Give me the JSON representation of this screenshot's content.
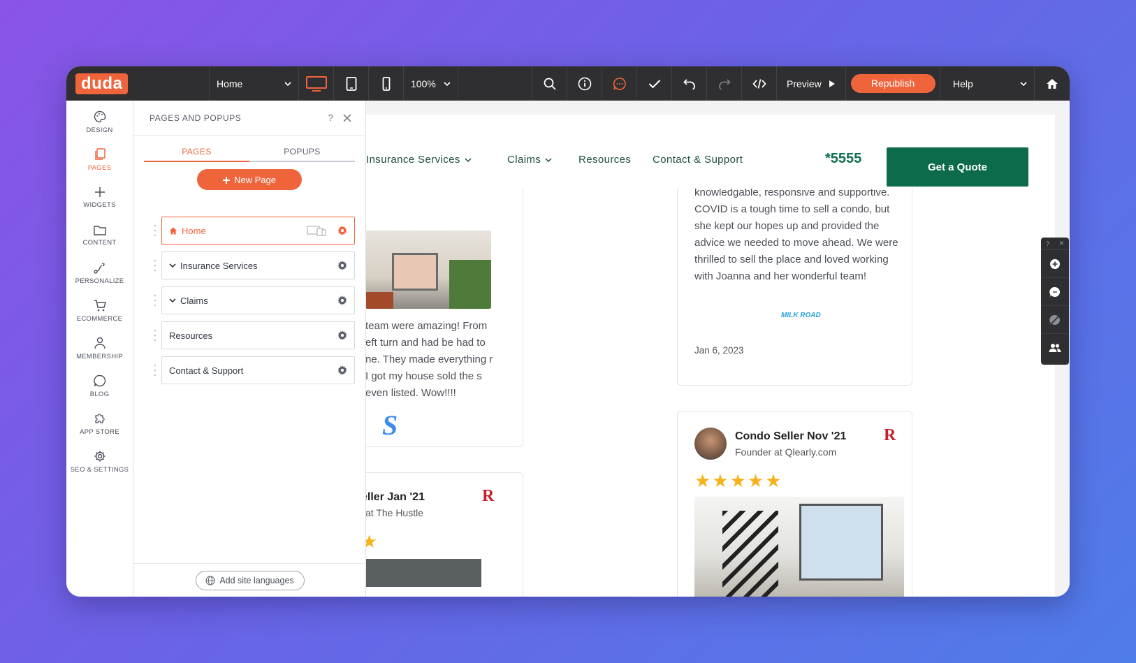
{
  "topbar": {
    "logo": "duda",
    "page_select": "Home",
    "zoom": "100%",
    "preview": "Preview",
    "republish": "Republish",
    "help": "Help"
  },
  "leftnav": {
    "items": [
      {
        "label": "DESIGN",
        "icon": "palette-icon"
      },
      {
        "label": "PAGES",
        "icon": "pages-icon"
      },
      {
        "label": "WIDGETS",
        "icon": "plus-icon"
      },
      {
        "label": "CONTENT",
        "icon": "folder-icon"
      },
      {
        "label": "PERSONALIZE",
        "icon": "personalize-icon"
      },
      {
        "label": "ECOMMERCE",
        "icon": "cart-icon"
      },
      {
        "label": "MEMBERSHIP",
        "icon": "user-icon"
      },
      {
        "label": "BLOG",
        "icon": "chat-icon"
      },
      {
        "label": "APP STORE",
        "icon": "puzzle-icon"
      },
      {
        "label": "SEO & SETTINGS",
        "icon": "gear-icon"
      }
    ]
  },
  "panel": {
    "title": "PAGES AND POPUPS",
    "help": "?",
    "tabs": [
      "PAGES",
      "POPUPS"
    ],
    "new_page": "New Page",
    "pages": [
      {
        "name": "Home"
      },
      {
        "name": "Insurance Services"
      },
      {
        "name": "Claims"
      },
      {
        "name": "Resources"
      },
      {
        "name": "Contact & Support"
      }
    ],
    "add_languages": "Add site languages"
  },
  "site": {
    "nav": {
      "insurance": "Insurance Services",
      "claims": "Claims",
      "resources": "Resources",
      "contact": "Contact & Support"
    },
    "phone": "*5555",
    "quote_button": "Get a Quote",
    "left_card": {
      "text": "team were amazing! From eft turn and had be had to ne. They made everything r I got my house sold the s even listed. Wow!!!!",
      "logo": "S"
    },
    "left_card2": {
      "name": "eller Jan '21",
      "role": "at The Hustle"
    },
    "right_card": {
      "text": "knowledgable, responsive and supportive. COVID is a tough time to sell a condo, but she kept our hopes up and provided the advice we needed to move ahead. We were thrilled to sell the place and loved working with Joanna and her wonderful team!",
      "brand": "MILK ROAD",
      "date": "Jan 6, 2023"
    },
    "right_card2": {
      "name": "Condo Seller Nov '21",
      "role": "Founder at Qlearly.com",
      "stars": "★★★★★"
    },
    "r_logo": "R",
    "stars_partial": "★"
  },
  "floatbar": {
    "help": "?",
    "close": "✕"
  }
}
